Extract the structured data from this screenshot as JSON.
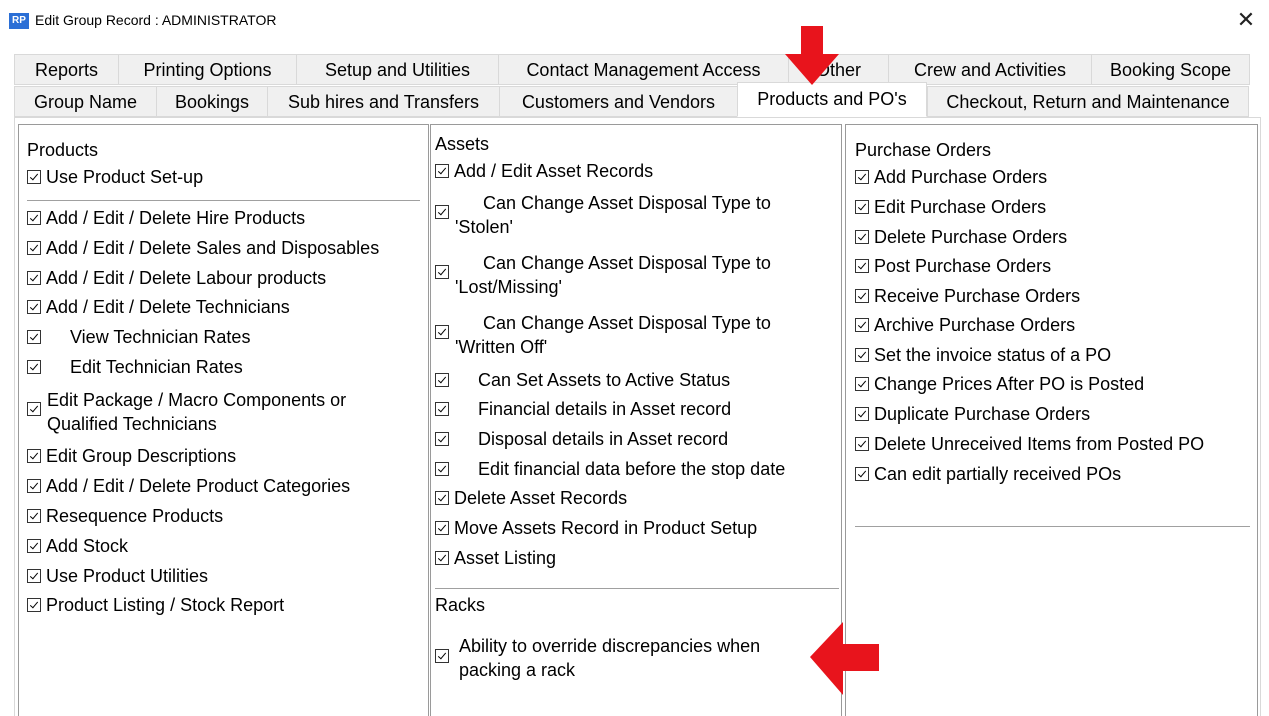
{
  "window": {
    "icon_text": "RP",
    "title": "Edit Group Record : ADMINISTRATOR",
    "close_glyph": "✕"
  },
  "tabs": {
    "row1": [
      "Reports",
      "Printing Options",
      "Setup and Utilities",
      "Contact Management Access",
      "Other",
      "Crew and Activities",
      "Booking Scope"
    ],
    "row2": [
      "Group Name",
      "Bookings",
      "Sub hires and Transfers",
      "Customers and Vendors",
      "Products and PO's",
      "Checkout, Return and Maintenance"
    ],
    "active": "Products and PO's"
  },
  "products": {
    "heading": "Products",
    "items": [
      "Use Product Set-up",
      "Add / Edit / Delete Hire Products",
      "Add / Edit / Delete Sales and Disposables",
      "Add / Edit / Delete Labour products",
      "Add / Edit / Delete Technicians",
      "View Technician Rates",
      "Edit Technician Rates",
      "Edit Package / Macro Components or",
      "Qualified Technicians",
      "Edit Group Descriptions",
      "Add / Edit / Delete Product Categories",
      "Resequence Products",
      "Add Stock",
      "Use Product Utilities",
      "Product Listing / Stock Report"
    ]
  },
  "assets": {
    "heading": "Assets",
    "items": [
      "Add / Edit Asset Records",
      "Can Change Asset Disposal Type to",
      "'Stolen'",
      "Can Change Asset Disposal Type to",
      "'Lost/Missing'",
      "Can Change Asset Disposal Type to",
      "'Written Off'",
      "Can Set Assets to Active Status",
      "Financial details in Asset record",
      "Disposal details in Asset record",
      "Edit financial data before the stop date",
      "Delete Asset Records",
      "Move Assets Record in Product Setup",
      "Asset Listing"
    ]
  },
  "racks": {
    "heading": "Racks",
    "items": [
      "Ability to override discrepancies when",
      "packing a rack"
    ]
  },
  "purchase_orders": {
    "heading": "Purchase Orders",
    "items": [
      "Add Purchase Orders",
      "Edit Purchase Orders",
      "Delete Purchase Orders",
      "Post Purchase Orders",
      "Receive Purchase Orders",
      "Archive Purchase Orders",
      "Set the invoice status of a PO",
      "Change Prices After PO is Posted",
      "Duplicate Purchase Orders",
      "Delete Unreceived Items from Posted PO",
      "Can edit partially received POs"
    ]
  },
  "colors": {
    "arrow": "#e8141c",
    "tab_bg": "#f0f0f0",
    "border": "#9a9a9a"
  }
}
